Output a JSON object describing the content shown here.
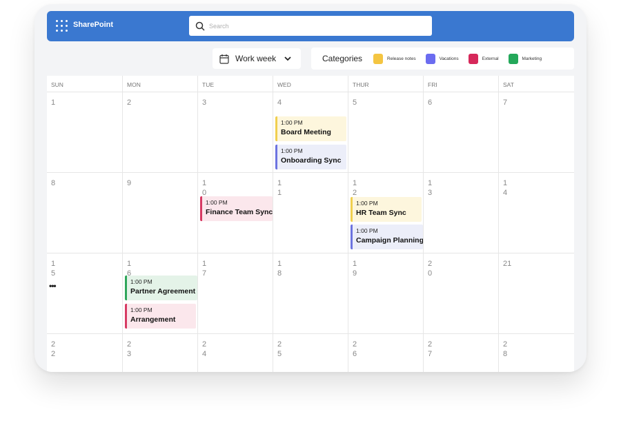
{
  "app": {
    "title": "SharePoint"
  },
  "search": {
    "placeholder": "Search",
    "value": ""
  },
  "view": {
    "label": "Work week"
  },
  "categories": {
    "title": "Categories",
    "items": [
      {
        "name": "Release notes",
        "color": "#f4c542"
      },
      {
        "name": "Vacations",
        "color": "#6b6cf0"
      },
      {
        "name": "External",
        "color": "#d6285a"
      },
      {
        "name": "Marketing",
        "color": "#24a85a"
      }
    ]
  },
  "calendar": {
    "weekdays": [
      "SUN",
      "MON",
      "TUE",
      "WED",
      "THUR",
      "FRI",
      "SAT"
    ],
    "weeks": [
      [
        "1",
        "2",
        "3",
        "4",
        "5",
        "6",
        "7"
      ],
      [
        "8",
        "9",
        "10",
        "11",
        "12",
        "13",
        "14"
      ],
      [
        "15",
        "16",
        "17",
        "18",
        "19",
        "20",
        "21"
      ],
      [
        "22",
        "23",
        "24",
        "25",
        "26",
        "27",
        "28"
      ]
    ],
    "more_indicator": "•••",
    "events": [
      {
        "time": "1:00 PM",
        "title": "Board Meeting",
        "category": "Release notes"
      },
      {
        "time": "1:00 PM",
        "title": "Onboarding Sync",
        "category": "Vacations"
      },
      {
        "time": "1:00 PM",
        "title": "Finance Team Sync",
        "category": "External"
      },
      {
        "time": "1:00 PM",
        "title": "HR Team Sync",
        "category": "Release notes"
      },
      {
        "time": "1:00 PM",
        "title": "Campaign Planning",
        "category": "Vacations"
      },
      {
        "time": "1:00 PM",
        "title": "Partner Agreement",
        "category": "Marketing"
      },
      {
        "time": "1:00 PM",
        "title": "Arrangement",
        "category": "External"
      }
    ]
  }
}
